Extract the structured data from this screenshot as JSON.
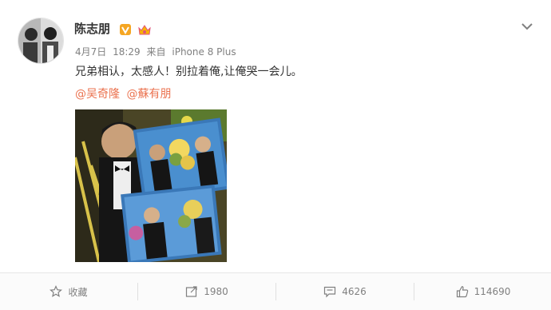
{
  "post": {
    "author": "陈志朋",
    "date": "4月7日",
    "time": "18:29",
    "via_label": "来自",
    "device": "iPhone 8 Plus",
    "text": "兄弟相认，太感人！别拉着俺,让俺哭一会儿。",
    "mentions": [
      "@吴奇隆",
      "@蘇有朋"
    ]
  },
  "actions": {
    "favorite_label": "收藏",
    "repost_count": "1980",
    "comment_count": "4626",
    "like_count": "114690"
  },
  "icons": {
    "verified": "verified-v-icon",
    "member": "member-crown-icon",
    "more": "chevron-down-icon",
    "favorite": "star-icon",
    "repost": "repost-icon",
    "comment": "comment-icon",
    "like": "thumbs-up-icon"
  },
  "colors": {
    "accent_orange": "#eb7350",
    "verified_badge": "#f5a623",
    "meta_gray": "#808080"
  }
}
